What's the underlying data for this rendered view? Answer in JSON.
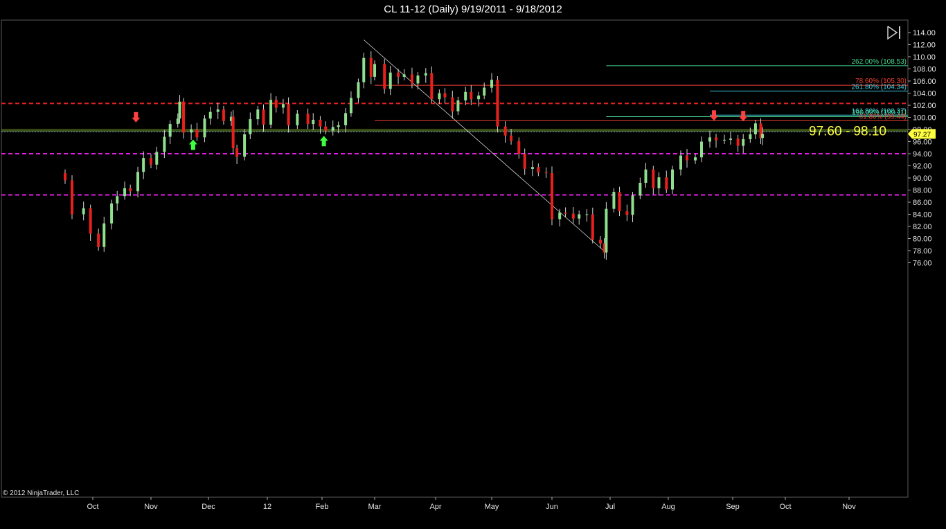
{
  "window": {
    "title": "CL 11-12 (Daily)  9/19/2011 - 9/18/2012",
    "copyright": "© 2012 NinjaTrader, LLC"
  },
  "colors": {
    "background": "#000000",
    "up_candle": "#8fdf8f",
    "down_candle": "#e8201c",
    "resistance_red": "#e02020",
    "support_magenta": "#e020e0",
    "zone_band": "#6f8f20",
    "price_marker": "#ffff40",
    "fib_green": "#48d890",
    "fib_cyan": "#40d0e8",
    "fib_red": "#f04030"
  },
  "icons": {
    "play_end": "play-to-end-icon"
  },
  "chart_data": {
    "type": "candlestick",
    "title": "CL 11-12 (Daily)  9/19/2011 - 9/18/2012",
    "ylim": [
      76,
      115
    ],
    "y_ticks": [
      "114.00",
      "112.00",
      "110.00",
      "108.00",
      "106.00",
      "104.00",
      "102.00",
      "100.00",
      "98.00",
      "96.00",
      "94.00",
      "92.00",
      "90.00",
      "88.00",
      "86.00",
      "84.00",
      "82.00",
      "80.00",
      "78.00",
      "76.00"
    ],
    "x_ticks": [
      {
        "label": "Oct",
        "date": "2011-10-01"
      },
      {
        "label": "Nov",
        "date": "2011-11-01"
      },
      {
        "label": "Dec",
        "date": "2011-12-01"
      },
      {
        "label": "12",
        "date": "2012-01-01"
      },
      {
        "label": "Feb",
        "date": "2012-02-01"
      },
      {
        "label": "Mar",
        "date": "2012-03-01"
      },
      {
        "label": "Apr",
        "date": "2012-04-01"
      },
      {
        "label": "May",
        "date": "2012-05-01"
      },
      {
        "label": "Jun",
        "date": "2012-06-01"
      },
      {
        "label": "Jul",
        "date": "2012-07-01"
      },
      {
        "label": "Aug",
        "date": "2012-08-01"
      },
      {
        "label": "Sep",
        "date": "2012-09-01"
      },
      {
        "label": "Oct",
        "date": "2012-10-01"
      },
      {
        "label": "Nov",
        "date": "2012-11-01"
      }
    ],
    "closes": [
      {
        "date": "2011-09-19",
        "close": 89.6
      },
      {
        "date": "2011-09-22",
        "close": 84.0
      },
      {
        "date": "2011-09-27",
        "close": 85.0
      },
      {
        "date": "2011-09-30",
        "close": 80.8
      },
      {
        "date": "2011-10-04",
        "close": 78.6
      },
      {
        "date": "2011-10-07",
        "close": 82.5
      },
      {
        "date": "2011-10-11",
        "close": 85.8
      },
      {
        "date": "2011-10-14",
        "close": 87.0
      },
      {
        "date": "2011-10-18",
        "close": 88.3
      },
      {
        "date": "2011-10-21",
        "close": 87.8
      },
      {
        "date": "2011-10-25",
        "close": 91.0
      },
      {
        "date": "2011-10-28",
        "close": 93.3
      },
      {
        "date": "2011-11-01",
        "close": 92.2
      },
      {
        "date": "2011-11-04",
        "close": 94.3
      },
      {
        "date": "2011-11-08",
        "close": 96.8
      },
      {
        "date": "2011-11-11",
        "close": 98.9
      },
      {
        "date": "2011-11-15",
        "close": 99.8
      },
      {
        "date": "2011-11-16",
        "close": 102.6
      },
      {
        "date": "2011-11-18",
        "close": 97.5
      },
      {
        "date": "2011-11-22",
        "close": 98.0
      },
      {
        "date": "2011-11-25",
        "close": 96.7
      },
      {
        "date": "2011-11-29",
        "close": 99.8
      },
      {
        "date": "2011-12-02",
        "close": 100.9
      },
      {
        "date": "2011-12-06",
        "close": 101.3
      },
      {
        "date": "2011-12-09",
        "close": 99.4
      },
      {
        "date": "2011-12-13",
        "close": 100.1
      },
      {
        "date": "2011-12-14",
        "close": 94.9
      },
      {
        "date": "2011-12-16",
        "close": 93.5
      },
      {
        "date": "2011-12-20",
        "close": 97.2
      },
      {
        "date": "2011-12-23",
        "close": 99.7
      },
      {
        "date": "2011-12-27",
        "close": 101.3
      },
      {
        "date": "2011-12-30",
        "close": 98.8
      },
      {
        "date": "2012-01-03",
        "close": 102.9
      },
      {
        "date": "2012-01-06",
        "close": 101.6
      },
      {
        "date": "2012-01-10",
        "close": 102.2
      },
      {
        "date": "2012-01-13",
        "close": 98.7
      },
      {
        "date": "2012-01-18",
        "close": 100.6
      },
      {
        "date": "2012-01-24",
        "close": 98.9
      },
      {
        "date": "2012-01-27",
        "close": 99.6
      },
      {
        "date": "2012-01-31",
        "close": 98.5
      },
      {
        "date": "2012-02-03",
        "close": 97.8
      },
      {
        "date": "2012-02-07",
        "close": 98.4
      },
      {
        "date": "2012-02-10",
        "close": 98.7
      },
      {
        "date": "2012-02-14",
        "close": 100.7
      },
      {
        "date": "2012-02-17",
        "close": 103.2
      },
      {
        "date": "2012-02-21",
        "close": 105.8
      },
      {
        "date": "2012-02-24",
        "close": 109.8
      },
      {
        "date": "2012-02-28",
        "close": 106.7
      },
      {
        "date": "2012-03-01",
        "close": 108.8
      },
      {
        "date": "2012-03-06",
        "close": 104.7
      },
      {
        "date": "2012-03-09",
        "close": 107.4
      },
      {
        "date": "2012-03-13",
        "close": 106.7
      },
      {
        "date": "2012-03-16",
        "close": 107.1
      },
      {
        "date": "2012-03-20",
        "close": 105.6
      },
      {
        "date": "2012-03-23",
        "close": 106.9
      },
      {
        "date": "2012-03-27",
        "close": 107.3
      },
      {
        "date": "2012-03-30",
        "close": 103.0
      },
      {
        "date": "2012-04-03",
        "close": 104.0
      },
      {
        "date": "2012-04-06",
        "close": 103.3
      },
      {
        "date": "2012-04-10",
        "close": 101.0
      },
      {
        "date": "2012-04-13",
        "close": 102.8
      },
      {
        "date": "2012-04-17",
        "close": 104.2
      },
      {
        "date": "2012-04-20",
        "close": 103.0
      },
      {
        "date": "2012-04-24",
        "close": 103.6
      },
      {
        "date": "2012-04-27",
        "close": 104.9
      },
      {
        "date": "2012-05-01",
        "close": 106.2
      },
      {
        "date": "2012-05-04",
        "close": 98.5
      },
      {
        "date": "2012-05-08",
        "close": 97.0
      },
      {
        "date": "2012-05-11",
        "close": 96.1
      },
      {
        "date": "2012-05-15",
        "close": 94.0
      },
      {
        "date": "2012-05-18",
        "close": 91.5
      },
      {
        "date": "2012-05-22",
        "close": 91.8
      },
      {
        "date": "2012-05-25",
        "close": 90.9
      },
      {
        "date": "2012-05-29",
        "close": 90.8
      },
      {
        "date": "2012-06-01",
        "close": 83.2
      },
      {
        "date": "2012-06-05",
        "close": 84.3
      },
      {
        "date": "2012-06-08",
        "close": 84.1
      },
      {
        "date": "2012-06-12",
        "close": 83.3
      },
      {
        "date": "2012-06-15",
        "close": 84.0
      },
      {
        "date": "2012-06-19",
        "close": 84.0
      },
      {
        "date": "2012-06-22",
        "close": 79.8
      },
      {
        "date": "2012-06-26",
        "close": 79.2
      },
      {
        "date": "2012-06-28",
        "close": 77.7
      },
      {
        "date": "2012-06-29",
        "close": 84.9
      },
      {
        "date": "2012-07-03",
        "close": 87.7
      },
      {
        "date": "2012-07-06",
        "close": 84.5
      },
      {
        "date": "2012-07-10",
        "close": 83.9
      },
      {
        "date": "2012-07-13",
        "close": 87.1
      },
      {
        "date": "2012-07-17",
        "close": 89.2
      },
      {
        "date": "2012-07-20",
        "close": 91.4
      },
      {
        "date": "2012-07-24",
        "close": 88.3
      },
      {
        "date": "2012-07-27",
        "close": 90.1
      },
      {
        "date": "2012-07-31",
        "close": 88.1
      },
      {
        "date": "2012-08-03",
        "close": 91.4
      },
      {
        "date": "2012-08-07",
        "close": 93.7
      },
      {
        "date": "2012-08-10",
        "close": 92.9
      },
      {
        "date": "2012-08-14",
        "close": 93.4
      },
      {
        "date": "2012-08-17",
        "close": 96.0
      },
      {
        "date": "2012-08-21",
        "close": 96.7
      },
      {
        "date": "2012-08-24",
        "close": 96.2
      },
      {
        "date": "2012-08-28",
        "close": 96.3
      },
      {
        "date": "2012-08-31",
        "close": 96.5
      },
      {
        "date": "2012-09-04",
        "close": 95.3
      },
      {
        "date": "2012-09-07",
        "close": 96.4
      },
      {
        "date": "2012-09-11",
        "close": 97.2
      },
      {
        "date": "2012-09-14",
        "close": 99.0
      },
      {
        "date": "2012-09-17",
        "close": 96.6
      },
      {
        "date": "2012-09-18",
        "close": 97.27
      }
    ],
    "last_price": "97.27",
    "zone_label": "97.60 - 98.10",
    "horizontal_lines": [
      {
        "value": 102.3,
        "style": "dashed",
        "color": "#e02020"
      },
      {
        "value": 94.0,
        "style": "dashed",
        "color": "#e020e0"
      },
      {
        "value": 87.2,
        "style": "dashed",
        "color": "#e020e0"
      }
    ],
    "zone": {
      "low": 97.6,
      "high": 98.1
    },
    "fib_levels": [
      {
        "label": "262.00% (108.53)",
        "value": 108.53,
        "color": "#48d890",
        "start": "2012-06-29"
      },
      {
        "label": "78.60% (105.30)",
        "value": 105.3,
        "color": "#f04030",
        "start": "2012-03-01"
      },
      {
        "label": "261.80% (104.34)",
        "value": 104.34,
        "color": "#40d0e8",
        "start": "2012-08-21"
      },
      {
        "label": "161.80% (100.37)",
        "value": 100.37,
        "color": "#40d0e8",
        "start": "2012-08-21"
      },
      {
        "label": "190.00% (100.11)",
        "value": 100.11,
        "color": "#48d890",
        "start": "2012-06-29"
      },
      {
        "label": "61.80% (99.44)",
        "value": 99.44,
        "color": "#f04030",
        "start": "2012-03-01"
      }
    ],
    "trendline": [
      {
        "date": "2012-02-24",
        "value": 112.8
      },
      {
        "date": "2012-06-28",
        "value": 77.9
      }
    ],
    "arrows": [
      {
        "direction": "down",
        "date": "2011-10-24",
        "value": 99.5,
        "color": "#ff4040"
      },
      {
        "direction": "up",
        "date": "2011-11-23",
        "value": 96.0,
        "color": "#40ff40"
      },
      {
        "direction": "up",
        "date": "2012-02-02",
        "value": 96.6,
        "color": "#40ff40"
      },
      {
        "direction": "down",
        "date": "2012-08-23",
        "value": 99.8,
        "color": "#ff4040"
      },
      {
        "direction": "down",
        "date": "2012-09-07",
        "value": 99.7,
        "color": "#ff4040"
      }
    ]
  }
}
